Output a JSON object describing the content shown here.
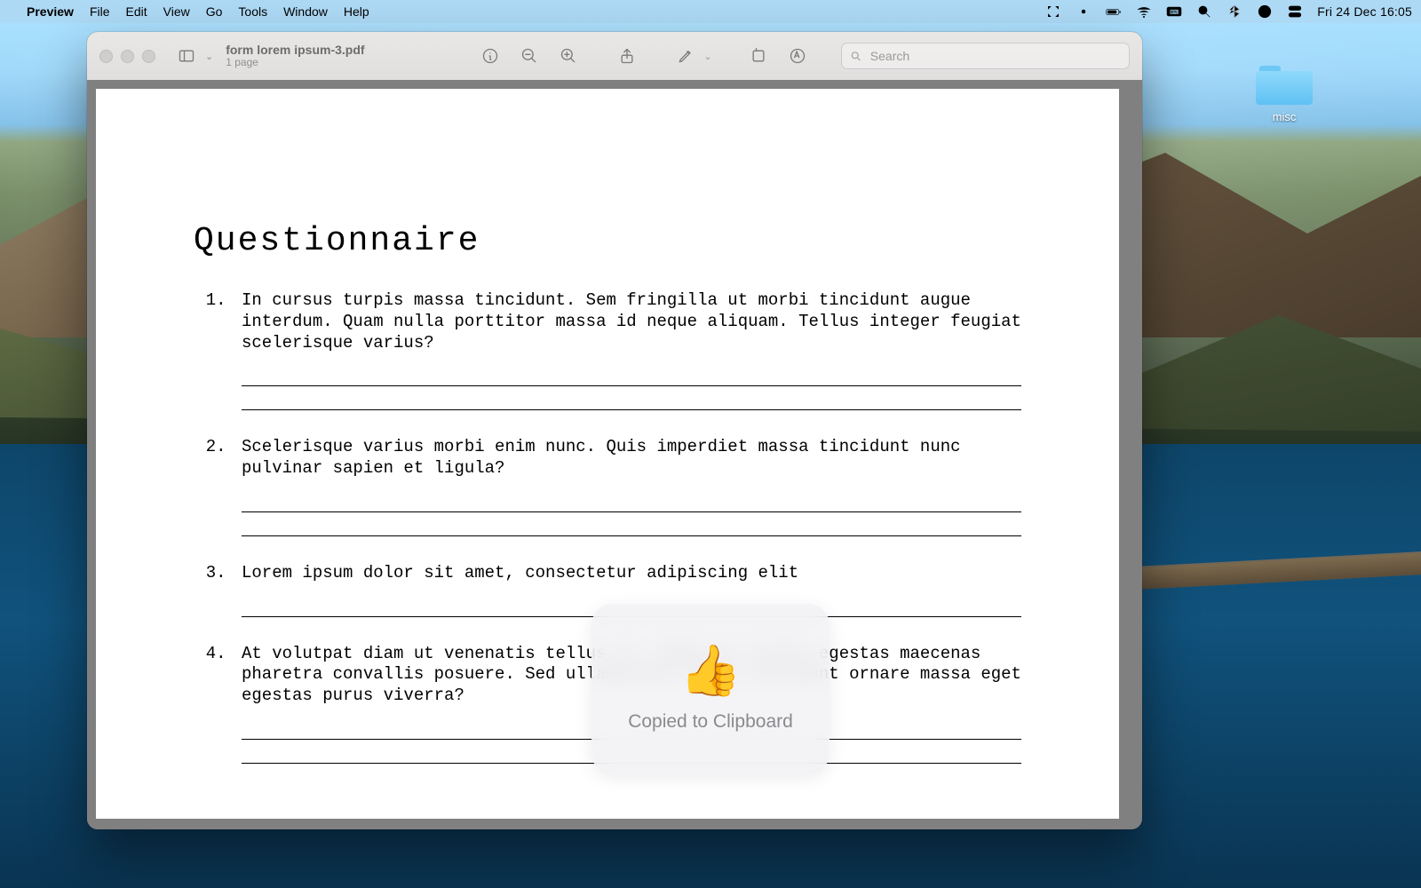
{
  "menubar": {
    "app_name": "Preview",
    "items": [
      "File",
      "Edit",
      "View",
      "Go",
      "Tools",
      "Window",
      "Help"
    ],
    "clock": "Fri 24 Dec  16:05"
  },
  "desktop": {
    "folder_label": "misc"
  },
  "window": {
    "title": "form lorem ipsum-3.pdf",
    "subtitle": "1 page",
    "search_placeholder": "Search"
  },
  "document": {
    "heading": "Questionnaire",
    "questions": [
      "In cursus turpis massa tincidunt. Sem fringilla ut morbi tincidunt augue interdum. Quam nulla porttitor massa id neque aliquam. Tellus integer feugiat scelerisque varius?",
      "Scelerisque varius morbi enim nunc. Quis imperdiet massa tincidunt nunc pulvinar sapien et ligula?",
      "Lorem ipsum dolor sit amet, consectetur adipiscing elit",
      "At volutpat diam ut venenatis tellus in. Fames ac turpis egestas maecenas pharetra convallis posuere. Sed ullamcorper morbi tincidunt ornare massa eget egestas purus viverra?"
    ],
    "answer_lines_per_q": [
      2,
      2,
      1,
      2
    ]
  },
  "hud": {
    "emoji": "👍",
    "message": "Copied to Clipboard"
  }
}
